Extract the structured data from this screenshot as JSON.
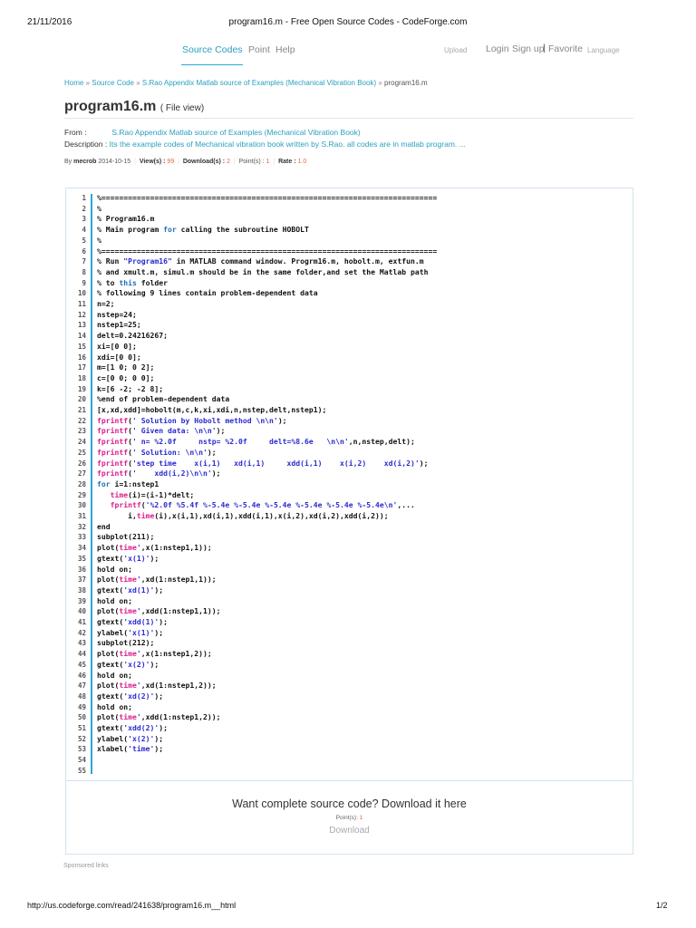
{
  "print_header": {
    "date": "21/11/2016",
    "title": "program16.m - Free Open Source Codes - CodeForge.com"
  },
  "nav": {
    "source_codes": "Source Codes",
    "point": "Point",
    "help": "Help",
    "upload": "Upload",
    "login": "Login",
    "signup": "Sign up",
    "sep": "|",
    "favorite": "Favorite",
    "language": "Language"
  },
  "breadcrumb": {
    "home": "Home",
    "sep": "»",
    "source_code": "Source Code",
    "category": "S.Rao Appendix Matlab source of Examples (Mechanical Vibration Book)",
    "current": "program16.m"
  },
  "page": {
    "title": "program16.m",
    "subtitle": "( File view)"
  },
  "info": {
    "from_label": "From :",
    "from_value": "S.Rao Appendix Matlab source of Examples (Mechanical Vibration Book)",
    "desc_label": "Description :",
    "desc_value": "Its the example codes of Mechanical vibration book written by S.Rao. all codes are in matlab program. ..."
  },
  "meta": {
    "by": "By",
    "author": "mecrob",
    "date": "2014-10-15",
    "views_label": "View(s) :",
    "views": "99",
    "downloads_label": "Download(s) :",
    "downloads": "2",
    "points_label": "Point(s) :",
    "points": "1",
    "rate_label": "Rate :",
    "rate": "1.0"
  },
  "code_lines": [
    [
      [
        "",
        "%============================================================================"
      ]
    ],
    [
      [
        "",
        "%"
      ]
    ],
    [
      [
        "",
        "% Program16.m"
      ]
    ],
    [
      [
        "",
        "% Main program "
      ],
      [
        "k",
        "for"
      ],
      [
        "",
        " calling the subroutine HOBOLT"
      ]
    ],
    [
      [
        "",
        "%"
      ]
    ],
    [
      [
        "",
        "%============================================================================"
      ]
    ],
    [
      [
        "",
        "% Run "
      ],
      [
        "s",
        "\"Program16\""
      ],
      [
        "",
        " in MATLAB command window. Progrm16.m, hobolt.m, extfun.m"
      ]
    ],
    [
      [
        "",
        "% and xmult.m, simul.m should be in the same folder,and set the Matlab path"
      ]
    ],
    [
      [
        "",
        "% to "
      ],
      [
        "k",
        "this"
      ],
      [
        "",
        " folder"
      ]
    ],
    [
      [
        "",
        "% following 9 lines contain problem-dependent data"
      ]
    ],
    [
      [
        "",
        "n=2;"
      ]
    ],
    [
      [
        "",
        "nstep=24;"
      ]
    ],
    [
      [
        "",
        "nstep1=25;"
      ]
    ],
    [
      [
        "",
        "delt=0.24216267;"
      ]
    ],
    [
      [
        "",
        "xi=[0 0];"
      ]
    ],
    [
      [
        "",
        "xdi=[0 0];"
      ]
    ],
    [
      [
        "",
        "m=[1 0; 0 2];"
      ]
    ],
    [
      [
        "",
        "c=[0 0; 0 0];"
      ]
    ],
    [
      [
        "",
        "k=[6 -2; -2 8];"
      ]
    ],
    [
      [
        "",
        "%end of problem-dependent data"
      ]
    ],
    [
      [
        "",
        "[x,xd,xdd]=hobolt(m,c,k,xi,xdi,n,nstep,delt,nstep1);"
      ]
    ],
    [
      [
        "f",
        "fprintf"
      ],
      [
        "",
        "("
      ],
      [
        "s",
        "' Solution by Hobolt method \\n\\n'"
      ],
      [
        "",
        ");"
      ]
    ],
    [
      [
        "f",
        "fprintf"
      ],
      [
        "",
        "("
      ],
      [
        "s",
        "' Given data: \\n\\n'"
      ],
      [
        "",
        ");"
      ]
    ],
    [
      [
        "f",
        "fprintf"
      ],
      [
        "",
        "("
      ],
      [
        "s",
        "' n= %2.0f     nstp= %2.0f     delt=%8.6e   \\n\\n'"
      ],
      [
        "",
        ",n,nstep,delt);"
      ]
    ],
    [
      [
        "f",
        "fprintf"
      ],
      [
        "",
        "("
      ],
      [
        "s",
        "' Solution: \\n\\n'"
      ],
      [
        "",
        ");"
      ]
    ],
    [
      [
        "f",
        "fprintf"
      ],
      [
        "",
        "("
      ],
      [
        "s",
        "'step time    x(i,1)   xd(i,1)     xdd(i,1)    x(i,2)    xd(i,2)'"
      ],
      [
        "",
        ");"
      ]
    ],
    [
      [
        "f",
        "fprintf"
      ],
      [
        "",
        "("
      ],
      [
        "s",
        "'    xdd(i,2)\\n\\n'"
      ],
      [
        "",
        ");"
      ]
    ],
    [
      [
        "k",
        "for"
      ],
      [
        "",
        " i=1:nstep1"
      ]
    ],
    [
      [
        "",
        "   "
      ],
      [
        "f",
        "time"
      ],
      [
        "",
        "(i)=(i-1)*delt;"
      ]
    ],
    [
      [
        "",
        "   "
      ],
      [
        "f",
        "fprintf"
      ],
      [
        "",
        "("
      ],
      [
        "s",
        "'%2.0f %5.4f %-5.4e %-5.4e %-5.4e %-5.4e %-5.4e %-5.4e\\n'"
      ],
      [
        "",
        ",..."
      ]
    ],
    [
      [
        "",
        "       i,"
      ],
      [
        "f",
        "time"
      ],
      [
        "",
        "(i),x(i,1),xd(i,1),xdd(i,1),x(i,2),xd(i,2),xdd(i,2));"
      ]
    ],
    [
      [
        "",
        "end"
      ]
    ],
    [
      [
        "",
        "subplot(211);"
      ]
    ],
    [
      [
        "",
        "plot("
      ],
      [
        "f",
        "time"
      ],
      [
        "s",
        "'"
      ],
      [
        "",
        ",x(1:nstep1,1));"
      ]
    ],
    [
      [
        "",
        "gtext("
      ],
      [
        "s",
        "'x(1)'"
      ],
      [
        "",
        ");"
      ]
    ],
    [
      [
        "",
        "hold on;"
      ]
    ],
    [
      [
        "",
        "plot("
      ],
      [
        "f",
        "time"
      ],
      [
        "s",
        "'"
      ],
      [
        "",
        ",xd(1:nstep1,1));"
      ]
    ],
    [
      [
        "",
        "gtext("
      ],
      [
        "s",
        "'xd(1)'"
      ],
      [
        "",
        ");"
      ]
    ],
    [
      [
        "",
        "hold on;"
      ]
    ],
    [
      [
        "",
        "plot("
      ],
      [
        "f",
        "time"
      ],
      [
        "s",
        "'"
      ],
      [
        "",
        ",xdd(1:nstep1,1));"
      ]
    ],
    [
      [
        "",
        "gtext("
      ],
      [
        "s",
        "'xdd(1)'"
      ],
      [
        "",
        ");"
      ]
    ],
    [
      [
        "",
        "ylabel("
      ],
      [
        "s",
        "'x(1)'"
      ],
      [
        "",
        ");"
      ]
    ],
    [
      [
        "",
        "subplot(212);"
      ]
    ],
    [
      [
        "",
        "plot("
      ],
      [
        "f",
        "time"
      ],
      [
        "s",
        "'"
      ],
      [
        "",
        ",x(1:nstep1,2));"
      ]
    ],
    [
      [
        "",
        "gtext("
      ],
      [
        "s",
        "'x(2)'"
      ],
      [
        "",
        ");"
      ]
    ],
    [
      [
        "",
        "hold on;"
      ]
    ],
    [
      [
        "",
        "plot("
      ],
      [
        "f",
        "time"
      ],
      [
        "s",
        "'"
      ],
      [
        "",
        ",xd(1:nstep1,2));"
      ]
    ],
    [
      [
        "",
        "gtext("
      ],
      [
        "s",
        "'xd(2)'"
      ],
      [
        "",
        ");"
      ]
    ],
    [
      [
        "",
        "hold on;"
      ]
    ],
    [
      [
        "",
        "plot("
      ],
      [
        "f",
        "time"
      ],
      [
        "s",
        "'"
      ],
      [
        "",
        ",xdd(1:nstep1,2));"
      ]
    ],
    [
      [
        "",
        "gtext("
      ],
      [
        "s",
        "'xdd(2)'"
      ],
      [
        "",
        ");"
      ]
    ],
    [
      [
        "",
        "ylabel("
      ],
      [
        "s",
        "'x(2)'"
      ],
      [
        "",
        ");"
      ]
    ],
    [
      [
        "",
        "xlabel("
      ],
      [
        "s",
        "'time'"
      ],
      [
        "",
        ");"
      ]
    ],
    [
      [
        "",
        ""
      ]
    ],
    [
      [
        "",
        ""
      ]
    ]
  ],
  "download": {
    "heading": "Want complete source code? Download it here",
    "points_label": "Point(s):",
    "points": "1",
    "button": "Download"
  },
  "sponsored": "Sponsored links",
  "print_footer": {
    "url": "http://us.codeforge.com/read/241638/program16.m__html",
    "page": "1/2"
  }
}
